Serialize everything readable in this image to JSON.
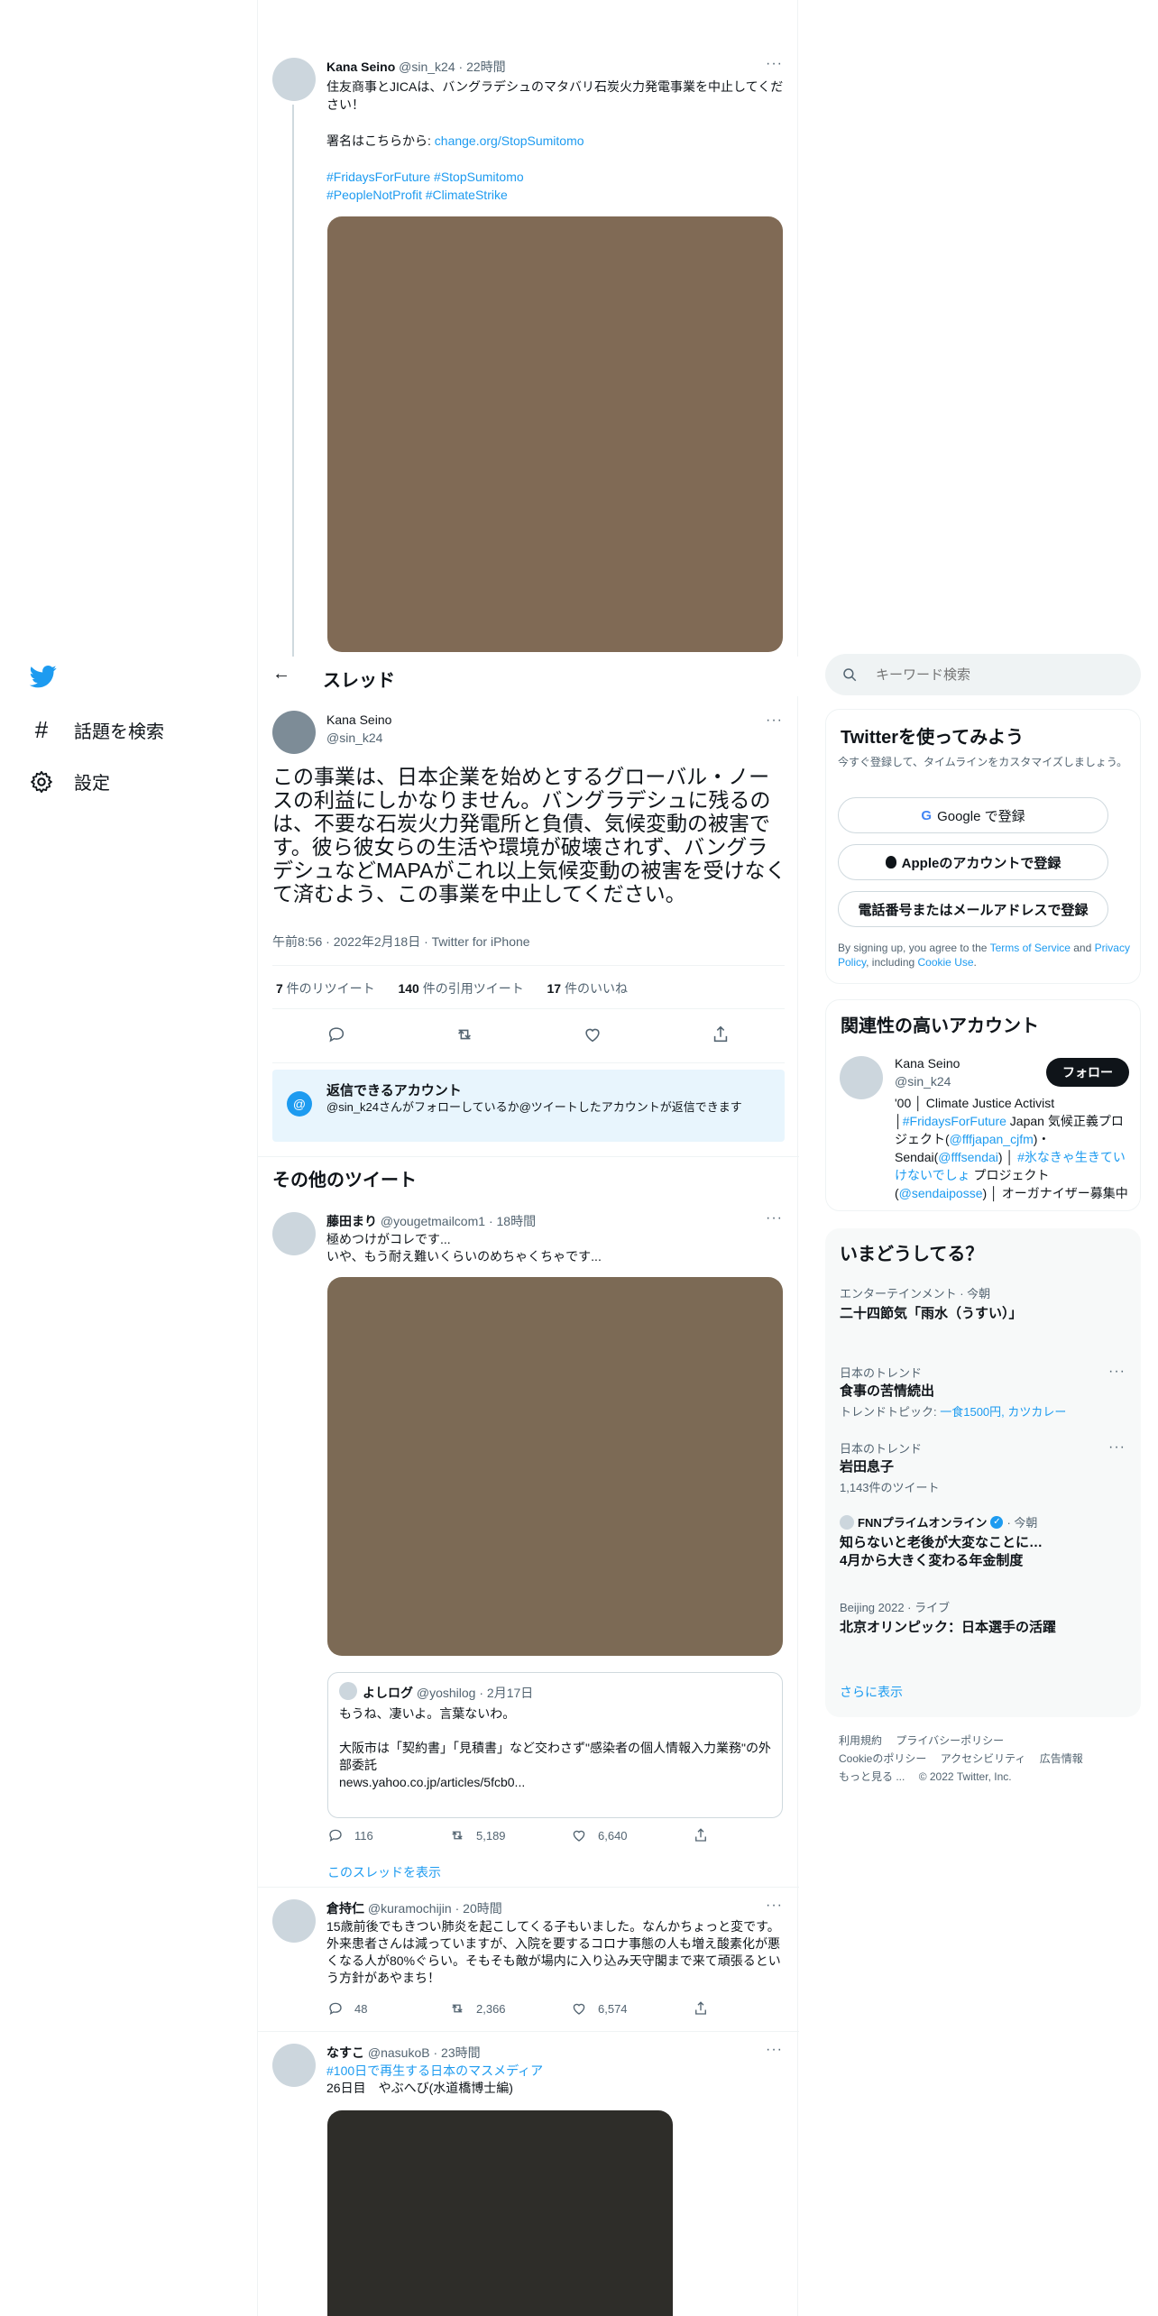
{
  "nav": {
    "explore": "話題を検索",
    "settings": "設定"
  },
  "header": {
    "title": "スレッド"
  },
  "parent_tweet": {
    "name": "Kana Seino",
    "handle": "@sin_k24",
    "time": "22時間",
    "line1": "住友商事とJICAは、バングラデシュのマタバリ石炭火力発電事業を中止してください！",
    "sign_prefix": "署名はこちらから: ",
    "sign_link": "change.org/StopSumitomo",
    "hashtags1": "#FridaysForFuture #StopSumitomo",
    "hashtags2": "#PeopleNotProfit #ClimateStrike"
  },
  "main_tweet": {
    "name": "Kana Seino",
    "handle": "@sin_k24",
    "text": "この事業は、日本企業を始めとするグローバル・ノースの利益にしかなりません。バングラデシュに残るのは、不要な石炭火力発電所と負債、気候変動の被害です。彼ら彼女らの生活や環境が破壊されず、バングラデシュなどMAPAがこれ以上気候変動の被害を受けなくて済むよう、この事業を中止してください。",
    "meta": "午前8:56 · 2022年2月18日 · Twitter for iPhone",
    "retweets_count": "7",
    "retweets_label": " 件のリツイート",
    "quotes_count": "140",
    "quotes_label": " 件の引用ツイート",
    "likes_count": "17",
    "likes_label": " 件のいいね"
  },
  "reply_notice": {
    "title": "返信できるアカウント",
    "text": "@sin_k24さんがフォローしているか@ツイートしたアカウントが返信できます"
  },
  "more_tweets": {
    "title": "その他のツイート"
  },
  "tweet1": {
    "name": "藤田まり",
    "handle": "@yougetmailcom1",
    "time": "18時間",
    "line1": "極めつけがコレです...",
    "line2": "いや、もう耐え難いくらいのめちゃくちゃです...",
    "quote_name": "よしログ",
    "quote_handle": "@yoshilog",
    "quote_time": "2月17日",
    "quote_line1": "もうね、凄いよ。言葉ないわ。",
    "quote_line2": "大阪市は「契約書」「見積書」など交わさず\"感染者の個人情報入力業務\"の外部委託",
    "quote_line3": "news.yahoo.co.jp/articles/5fcb0...",
    "replies": "116",
    "retweets": "5,189",
    "likes": "6,640",
    "show_thread": "このスレッドを表示"
  },
  "tweet2": {
    "name": "倉持仁",
    "handle": "@kuramochijin",
    "time": "20時間",
    "text": "15歳前後でもきつい肺炎を起こしてくる子もいました。なんかちょっと変です。外来患者さんは減っていますが、入院を要するコロナ事態の人も増え酸素化が悪くなる人が80%ぐらい。そもそも敵が場内に入り込み天守閣まで来て頑張るという方針があやまち！",
    "replies": "48",
    "retweets": "2,366",
    "likes": "6,574"
  },
  "tweet3": {
    "name": "なすこ",
    "handle": "@nasukoB",
    "time": "23時間",
    "hashtag": "#100日で再生する日本のマスメディア",
    "line2": "26日目　やぶへび(水道橋博士編)"
  },
  "search": {
    "placeholder": "キーワード検索"
  },
  "signup": {
    "title": "Twitterを使ってみよう",
    "subtitle": "今すぐ登録して、タイムラインをカスタマイズしましょう。",
    "google": "Google で登録",
    "apple": "Appleのアカウントで登録",
    "phone": "電話番号またはメールアドレスで登録",
    "terms_1": "By signing up, you agree to the ",
    "terms_tos": "Terms of Service",
    "terms_2": " and ",
    "terms_privacy": "Privacy Policy",
    "terms_3": ", including ",
    "terms_cookie": "Cookie Use",
    "terms_4": "."
  },
  "related": {
    "title": "関連性の高いアカウント",
    "name": "Kana Seino",
    "handle": "@sin_k24",
    "follow": "フォロー",
    "bio_1": "'00 │ Climate Justice Activist　 │",
    "bio_ff": "#FridaysForFuture",
    "bio_2": " Japan 気候正義プロジェクト(",
    "bio_fffjapan": "@fffjapan_cjfm",
    "bio_3": ")・Sendai(",
    "bio_fffsendai": "@fffsendai",
    "bio_4": ") │ ",
    "bio_tag": "#氷なきゃ生きていけないでしょ",
    "bio_5": " プロジェクト(",
    "bio_posse": "@sendaiposse",
    "bio_6": ") │ オーガナイザー募集中"
  },
  "trends": {
    "title": "いまどうしてる？",
    "t1_cat": "エンターテインメント · 今朝",
    "t1_name": "二十四節気「雨水（うすい）」",
    "t2_cat": "日本のトレンド",
    "t2_name": "食事の苦情続出",
    "t2_sub_prefix": "トレンドトピック: ",
    "t2_sub_link": "一食1500円, カツカレー",
    "t3_cat": "日本のトレンド",
    "t3_name": "岩田息子",
    "t3_sub": "1,143件のツイート",
    "t4_source": "FNNプライムオンライン",
    "t4_time": "· 今朝",
    "t4_line1": "知らないと老後が大変なことに…",
    "t4_line2": "4月から大きく変わる年金制度",
    "t5_cat": "Beijing 2022 · ライブ",
    "t5_name": "北京オリンピック：日本選手の活躍",
    "show_more": "さらに表示"
  },
  "footer": {
    "terms": "利用規約",
    "privacy": "プライバシーポリシー",
    "cookie": "Cookieのポリシー",
    "accessibility": "アクセシビリティ",
    "ads": "広告情報",
    "more": "もっと見る ...",
    "copyright": "© 2022 Twitter, Inc."
  },
  "colors": {
    "accent": "#1d9bf0",
    "media_brown": "#806a55",
    "media_brown2": "#7c6a55",
    "media_dark": "#2e2d29"
  }
}
